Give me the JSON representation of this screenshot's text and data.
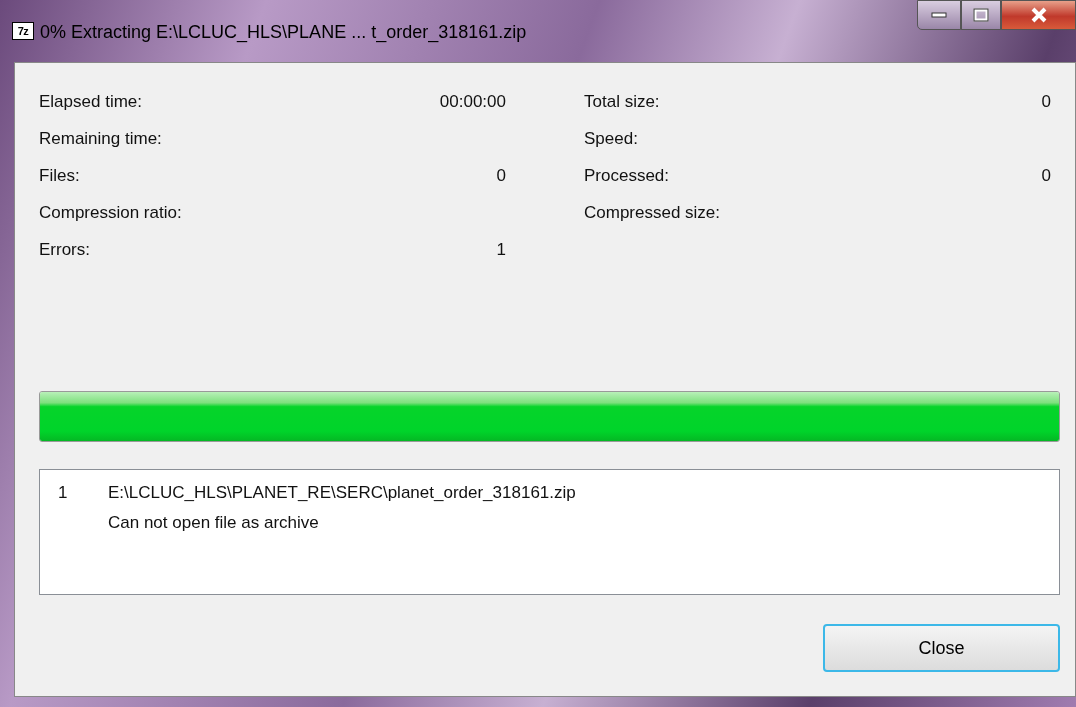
{
  "window": {
    "icon_text": "7z",
    "title": "0% Extracting E:\\LCLUC_HLS\\PLANE ... t_order_318161.zip"
  },
  "stats_left": [
    {
      "label": "Elapsed time:",
      "value": "00:00:00"
    },
    {
      "label": "Remaining time:"
    },
    {
      "label": "Files:",
      "value": "0"
    },
    {
      "label": "Compression ratio:"
    },
    {
      "label": "Errors:",
      "value": "1"
    }
  ],
  "stats_right": [
    {
      "label": "Total size:",
      "value": "0"
    },
    {
      "label": "Speed:"
    },
    {
      "label": "Processed:",
      "value": "0"
    },
    {
      "label": "Compressed size:"
    }
  ],
  "progress": {
    "level": 1
  },
  "messages": [
    {
      "number": "1",
      "lines": [
        "E:\\LCLUC_HLS\\PLANET_RE\\SERC\\planet_order_318161.zip",
        "Can not open file as archive"
      ]
    }
  ],
  "buttons": [
    "Close"
  ]
}
